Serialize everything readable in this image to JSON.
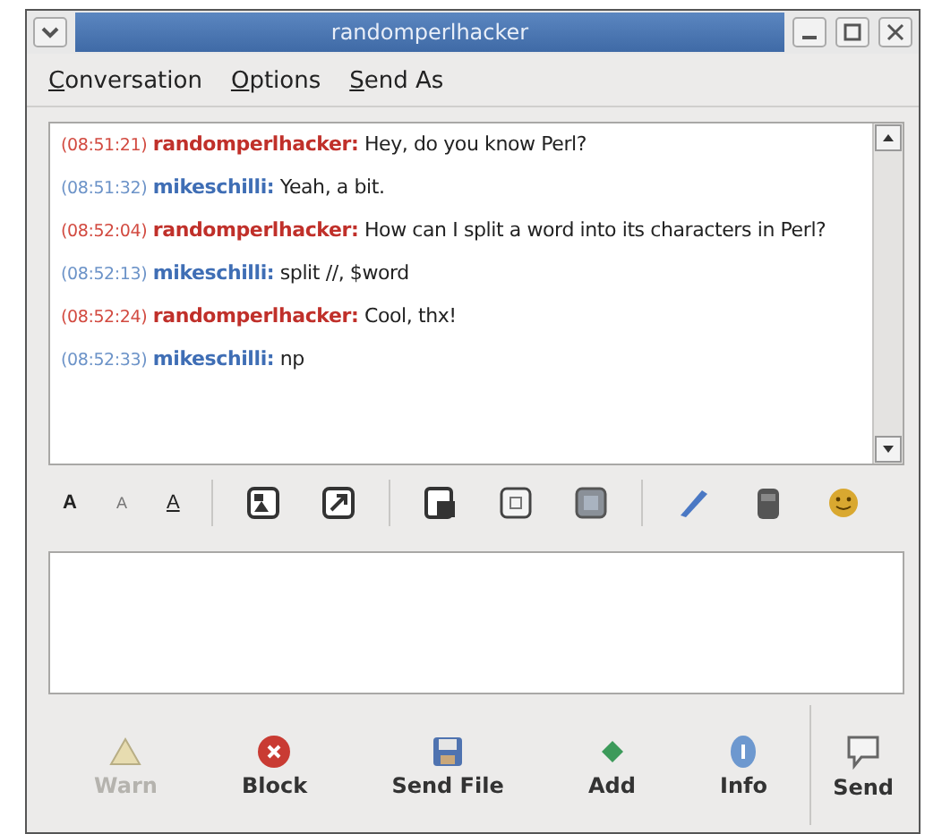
{
  "window": {
    "title": "randomperlhacker"
  },
  "menu": [
    "Conversation",
    "Options",
    "Send As"
  ],
  "messages": [
    {
      "time": "(08:51:21)",
      "sender": "randomperlhacker:",
      "text": "Hey, do you know Perl?",
      "kind": "remote"
    },
    {
      "time": "(08:51:32)",
      "sender": "mikeschilli:",
      "text": "Yeah, a bit.",
      "kind": "local"
    },
    {
      "time": "(08:52:04)",
      "sender": "randomperlhacker:",
      "text": "How can I split a word into its characters in Perl?",
      "kind": "remote"
    },
    {
      "time": "(08:52:13)",
      "sender": "mikeschilli:",
      "text": "split //, $word",
      "kind": "local"
    },
    {
      "time": "(08:52:24)",
      "sender": "randomperlhacker:",
      "text": "Cool, thx!",
      "kind": "remote"
    },
    {
      "time": "(08:52:33)",
      "sender": "mikeschilli:",
      "text": "np",
      "kind": "local"
    }
  ],
  "format_buttons": [
    {
      "label": "A",
      "kind": "bold"
    },
    {
      "label": "A",
      "kind": "small"
    },
    {
      "label": "A",
      "kind": "underline"
    }
  ],
  "actions": [
    {
      "label": "Warn",
      "kind": "warn",
      "disabled": true
    },
    {
      "label": "Block",
      "kind": "block",
      "disabled": false
    },
    {
      "label": "Send File",
      "kind": "file",
      "disabled": false
    },
    {
      "label": "Add",
      "kind": "add",
      "disabled": false
    },
    {
      "label": "Info",
      "kind": "info",
      "disabled": false
    }
  ],
  "send_button": {
    "label": "Send"
  }
}
